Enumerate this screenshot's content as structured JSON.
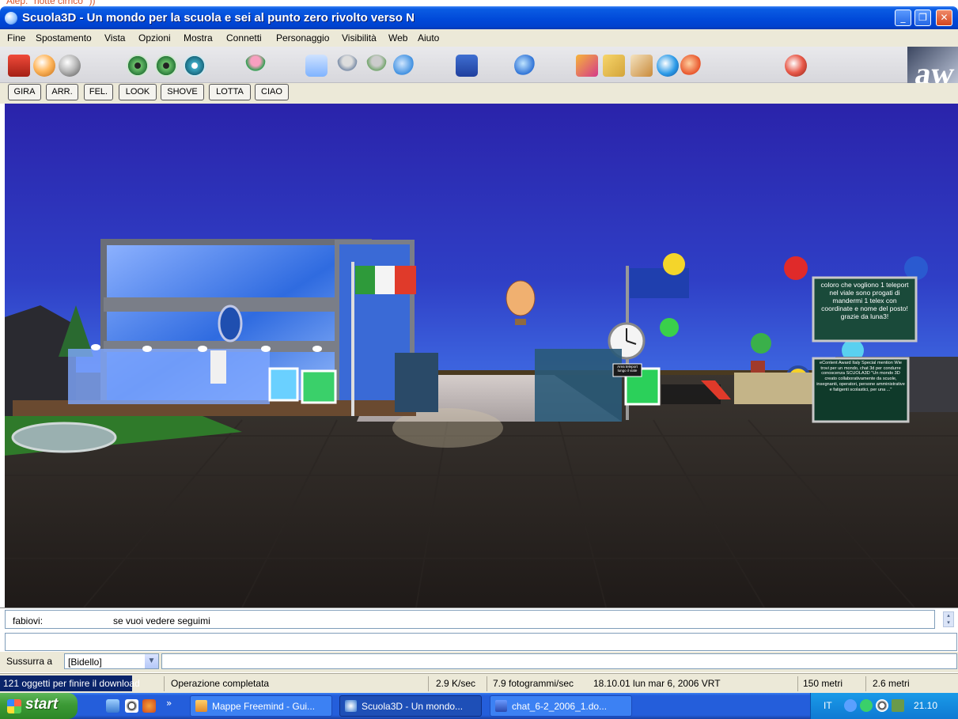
{
  "top_caption": "Alep: \"notte cirrico\" ))",
  "window": {
    "title": "Scuola3D - Un mondo per la scuola e sei al punto zero rivolto verso N",
    "min": "_",
    "max": "❐",
    "close": "✕"
  },
  "menu": [
    "Fine",
    "Spostamento",
    "Vista",
    "Opzioni",
    "Mostra",
    "Connetti",
    "Personaggio",
    "Visibilità",
    "Web",
    "Aiuto"
  ],
  "toolbar_icons": [
    "home-icon",
    "back-icon",
    "forward-icon",
    "eye-icon",
    "eye-icon",
    "eye-icon",
    "avatar-icon",
    "person-icon",
    "person-icon",
    "person-icon",
    "group-icon",
    "afk-icon",
    "browser-icon",
    "paint-icon",
    "notes-icon",
    "map-icon",
    "globe-icon",
    "help-icon",
    "exit-icon"
  ],
  "logo": "aw",
  "actions": [
    "GIRA",
    "ARR.",
    "FEL.",
    "LOOK",
    "SHOVE",
    "LOTTA",
    "CIAO"
  ],
  "scene": {
    "sign_teleport": "coloro che vogliono 1 teleport nel viale sono progati di mandermi 1 telex con coordinate e nome del posto! grazie da luna3!",
    "sign_award": "eContent Award Italy Special mention Wie trovi per un mondo, chat 3d per condurre conoscenza SCUOLA3D \"Un mondo 3D creato collaborativamente da scuole, insegnanti, operatori, persone amministrative e fatigenti scolastici, per una ...\"",
    "sign_small": "Area teleport lungo il viale"
  },
  "chat": {
    "user": "fabiovi:",
    "message": "se vuoi vedere seguimi",
    "scroll_up": "▴",
    "scroll_down": "▾"
  },
  "whisper": {
    "label": "Sussurra a",
    "selected": "[Bidello]",
    "arrow": "▼"
  },
  "status": {
    "download": "121 oggetti per finire il download",
    "operation": "Operazione completata",
    "speed": "2.9 K/sec",
    "fps": "7.9 fotogrammi/sec",
    "time": "18.10.01 lun mar 6, 2006 VRT",
    "distance": "150 metri",
    "height": "2.6 metri"
  },
  "taskbar": {
    "start": "start",
    "more": "»",
    "tasks": [
      "Mappe Freemind - Gui...",
      "Scuola3D - Un mondo...",
      "chat_6-2_2006_1.do..."
    ],
    "lang": "IT",
    "clock": "21.10"
  }
}
